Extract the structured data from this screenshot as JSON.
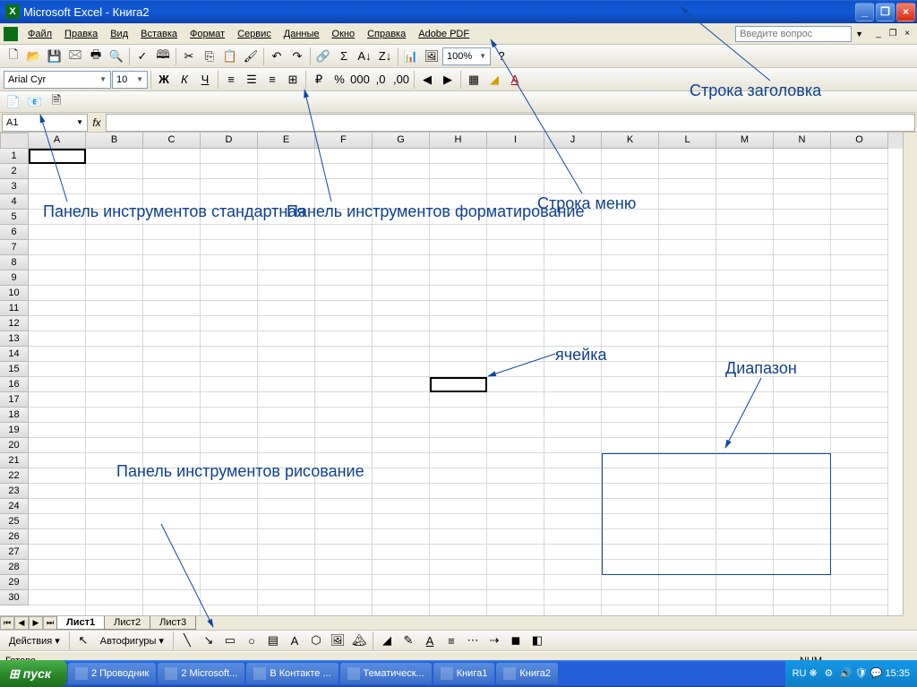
{
  "window": {
    "title": "Microsoft Excel - Книга2"
  },
  "menu": {
    "items": [
      "Файл",
      "Правка",
      "Вид",
      "Вставка",
      "Формат",
      "Сервис",
      "Данные",
      "Окно",
      "Справка",
      "Adobe PDF"
    ],
    "help_placeholder": "Введите вопрос"
  },
  "toolbar_std": {
    "zoom": "100%"
  },
  "toolbar_fmt": {
    "font_name": "Arial Cyr",
    "font_size": "10"
  },
  "namebox": {
    "value": "A1"
  },
  "columns": [
    "A",
    "B",
    "C",
    "D",
    "E",
    "F",
    "G",
    "H",
    "I",
    "J",
    "K",
    "L",
    "M",
    "N",
    "O"
  ],
  "rows": [
    "1",
    "2",
    "3",
    "4",
    "5",
    "6",
    "7",
    "8",
    "9",
    "10",
    "11",
    "12",
    "13",
    "14",
    "15",
    "16",
    "17",
    "18",
    "19",
    "20",
    "21",
    "22",
    "23",
    "24",
    "25",
    "26",
    "27",
    "28",
    "29",
    "30"
  ],
  "sheets": {
    "tabs": [
      "Лист1",
      "Лист2",
      "Лист3"
    ],
    "active": 0
  },
  "drawing": {
    "actions": "Действия",
    "autoshapes": "Автофигуры"
  },
  "status": {
    "ready": "Готово",
    "num": "NUM"
  },
  "taskbar": {
    "start": "пуск",
    "buttons": [
      "2 Проводник",
      "2 Microsoft...",
      "В Контакте ...",
      "Тематическ...",
      "Книга1",
      "Книга2"
    ],
    "lang": "RU",
    "time": "15:35"
  },
  "annotations": {
    "titlebar": "Строка заголовка",
    "menubar": "Строка меню",
    "toolbar_std": "Панель инструментов стандартная",
    "toolbar_fmt": "Панель инструментов форматирование",
    "toolbar_draw": "Панель инструментов рисование",
    "cell": "ячейка",
    "range": "Диапазон"
  }
}
